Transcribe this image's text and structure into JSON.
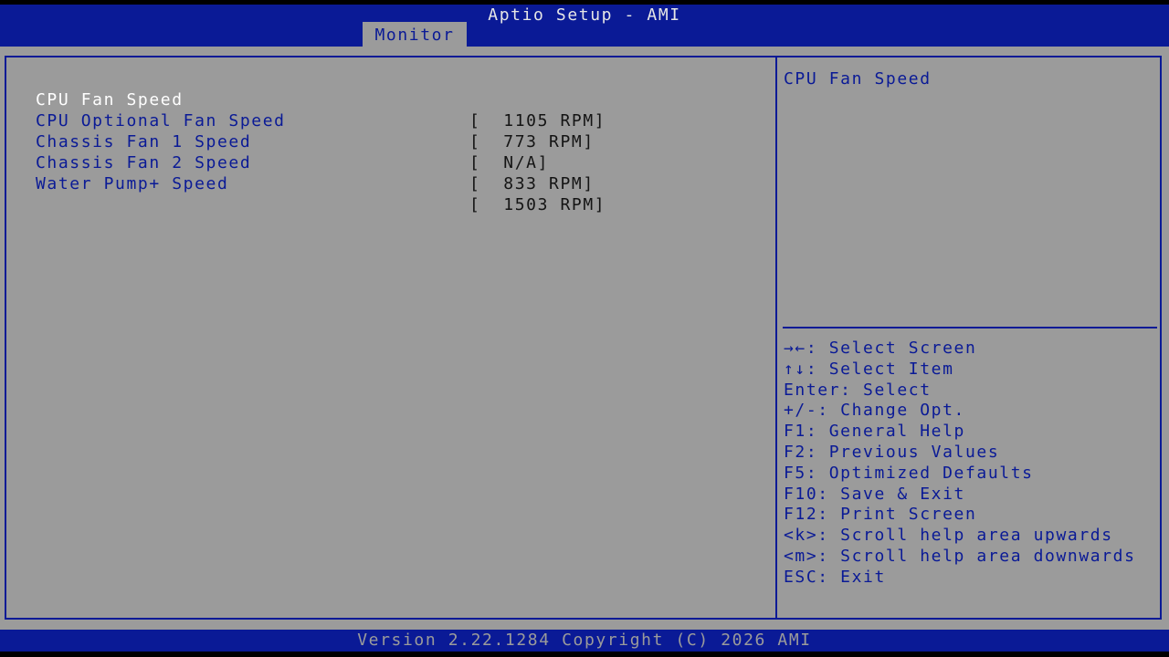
{
  "header": {
    "title": "Aptio Setup - AMI",
    "tabs": [
      {
        "label": "Monitor",
        "active": true
      }
    ]
  },
  "items": [
    {
      "label": "CPU Fan Speed",
      "value": "[  1105 RPM]",
      "selected": true
    },
    {
      "label": "CPU Optional Fan Speed",
      "value": "[  773 RPM]",
      "selected": false
    },
    {
      "label": "Chassis Fan 1 Speed",
      "value": "[  N/A]",
      "selected": false
    },
    {
      "label": "Chassis Fan 2 Speed",
      "value": "[  833 RPM]",
      "selected": false
    },
    {
      "label": "Water Pump+ Speed",
      "value": "[  1503 RPM]",
      "selected": false
    }
  ],
  "help": {
    "title": "CPU Fan Speed",
    "keys": [
      "→←: Select Screen",
      "↑↓: Select Item",
      "Enter: Select",
      "+/-: Change Opt.",
      "F1: General Help",
      "F2: Previous Values",
      "F5: Optimized Defaults",
      "F10: Save & Exit",
      "F12: Print Screen",
      "<k>: Scroll help area upwards",
      "<m>: Scroll help area downwards",
      "ESC: Exit"
    ]
  },
  "footer": {
    "version": "Version 2.22.1284 Copyright (C) 2026 AMI"
  },
  "colors": {
    "bar_blue": "#0a1a96",
    "panel_gray": "#9b9b9b",
    "selected_text": "#ffffff",
    "value_text": "#141414"
  }
}
